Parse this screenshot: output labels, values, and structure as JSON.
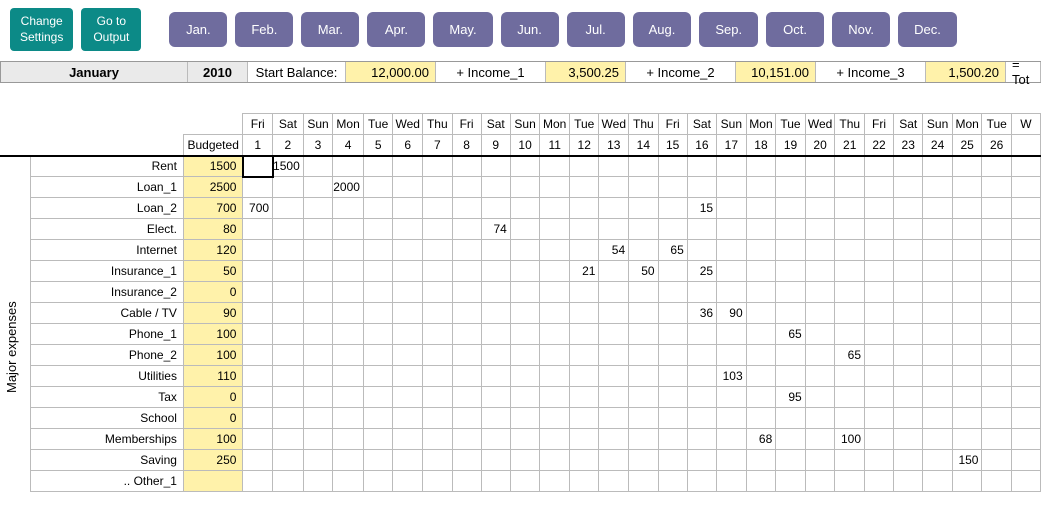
{
  "buttons": {
    "change_settings": "Change\nSettings",
    "goto_output": "Go to\nOutput"
  },
  "months": [
    "Jan.",
    "Feb.",
    "Mar.",
    "Apr.",
    "May.",
    "Jun.",
    "Jul.",
    "Aug.",
    "Sep.",
    "Oct.",
    "Nov.",
    "Dec."
  ],
  "summary": {
    "month": "January",
    "year": "2010",
    "start_balance_label": "Start Balance:",
    "start_balance": "12,000.00",
    "income1_label": "+ Income_1",
    "income1": "3,500.25",
    "income2_label": "+ Income_2",
    "income2": "10,151.00",
    "income3_label": "+ Income_3",
    "income3": "1,500.20",
    "total_label": "= Tot"
  },
  "section_label": "Major expenses",
  "headers": {
    "budgeted": "Budgeted",
    "weekdays": [
      "Fri",
      "Sat",
      "Sun",
      "Mon",
      "Tue",
      "Wed",
      "Thu",
      "Fri",
      "Sat",
      "Sun",
      "Mon",
      "Tue",
      "Wed",
      "Thu",
      "Fri",
      "Sat",
      "Sun",
      "Mon",
      "Tue",
      "Wed",
      "Thu",
      "Fri",
      "Sat",
      "Sun",
      "Mon",
      "Tue",
      "W"
    ],
    "daynums": [
      "1",
      "2",
      "3",
      "4",
      "5",
      "6",
      "7",
      "8",
      "9",
      "10",
      "11",
      "12",
      "13",
      "14",
      "15",
      "16",
      "17",
      "18",
      "19",
      "20",
      "21",
      "22",
      "23",
      "24",
      "25",
      "26",
      ""
    ]
  },
  "rows": [
    {
      "label": "Rent",
      "budget": "1500",
      "cells": {
        "2": "1500"
      }
    },
    {
      "label": "Loan_1",
      "budget": "2500",
      "cells": {
        "4": "2000"
      }
    },
    {
      "label": "Loan_2",
      "budget": "700",
      "cells": {
        "1": "700",
        "16": "15"
      }
    },
    {
      "label": "Elect.",
      "budget": "80",
      "cells": {
        "9": "74"
      }
    },
    {
      "label": "Internet",
      "budget": "120",
      "cells": {
        "13": "54",
        "15": "65"
      }
    },
    {
      "label": "Insurance_1",
      "budget": "50",
      "cells": {
        "12": "21",
        "14": "50",
        "16": "25"
      }
    },
    {
      "label": "Insurance_2",
      "budget": "0",
      "cells": {}
    },
    {
      "label": "Cable / TV",
      "budget": "90",
      "cells": {
        "16": "36",
        "17": "90"
      }
    },
    {
      "label": "Phone_1",
      "budget": "100",
      "cells": {
        "19": "65"
      }
    },
    {
      "label": "Phone_2",
      "budget": "100",
      "cells": {
        "21": "65"
      }
    },
    {
      "label": "Utilities",
      "budget": "110",
      "cells": {
        "17": "103"
      }
    },
    {
      "label": "Tax",
      "budget": "0",
      "cells": {
        "19": "95"
      }
    },
    {
      "label": "School",
      "budget": "0",
      "cells": {}
    },
    {
      "label": "Memberships",
      "budget": "100",
      "cells": {
        "18": "68",
        "21": "100"
      }
    },
    {
      "label": "Saving",
      "budget": "250",
      "cells": {
        "25": "150"
      }
    },
    {
      "label": ".. Other_1",
      "budget": "",
      "cells": {}
    }
  ],
  "selected_cell": {
    "row": 0,
    "day": 1
  }
}
